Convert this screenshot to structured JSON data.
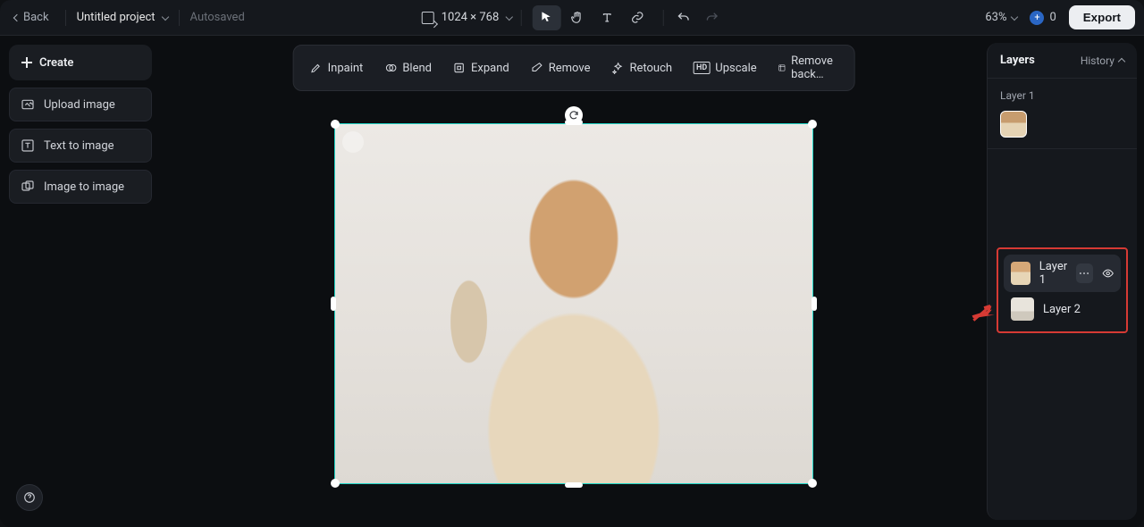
{
  "header": {
    "back": "Back",
    "project_name": "Untitled project",
    "autosaved": "Autosaved",
    "dimensions": "1024 × 768",
    "zoom": "63%",
    "credits": "0",
    "export": "Export"
  },
  "left": {
    "create": "Create",
    "upload": "Upload image",
    "text_to_image": "Text to image",
    "image_to_image": "Image to image"
  },
  "actions": {
    "inpaint": "Inpaint",
    "blend": "Blend",
    "expand": "Expand",
    "remove": "Remove",
    "retouch": "Retouch",
    "upscale": "Upscale",
    "remove_bg": "Remove back…"
  },
  "right": {
    "title": "Layers",
    "history": "History",
    "section_label": "Layer 1",
    "layer1": "Layer 1",
    "layer2": "Layer 2"
  }
}
